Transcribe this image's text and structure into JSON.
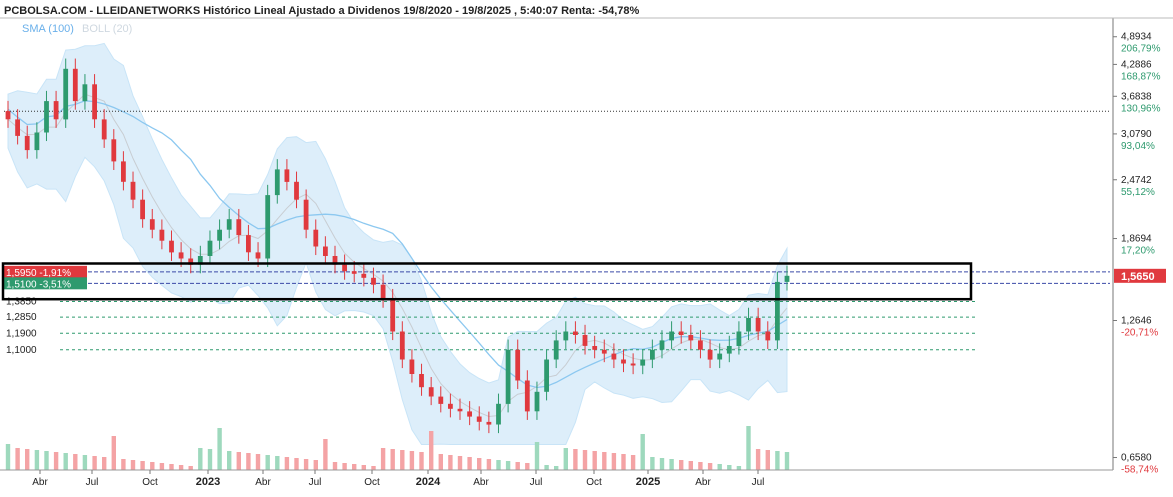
{
  "title": "PCBOLSA.COM - LLEIDANETWORKS Histórico Lineal Ajustado a Dividenos 19/8/2020 - 19/8/2025 , 5:40:07 Renta: -54,78%",
  "indicators": [
    {
      "label": "SMA (100)",
      "color": "#6ab0ea"
    },
    {
      "label": "BOLL (20)",
      "color": "#cfd8e0"
    }
  ],
  "colors": {
    "up": "#2e9a6e",
    "down": "#e0393e",
    "boll_fill": "#d8ecfa",
    "sma": "#8cc8f0",
    "box": "#000000"
  },
  "chart_data": {
    "type": "candlestick",
    "y_scale": "log",
    "ylim": [
      0.62,
      5.3
    ],
    "x_ticks": [
      {
        "label": "Abr",
        "year": false
      },
      {
        "label": "Jul",
        "year": false
      },
      {
        "label": "Oct",
        "year": false
      },
      {
        "label": "2023",
        "year": true
      },
      {
        "label": "Abr",
        "year": false
      },
      {
        "label": "Jul",
        "year": false
      },
      {
        "label": "Oct",
        "year": false
      },
      {
        "label": "2024",
        "year": true
      },
      {
        "label": "Abr",
        "year": false
      },
      {
        "label": "Jul",
        "year": false
      },
      {
        "label": "Oct",
        "year": false
      },
      {
        "label": "2025",
        "year": true
      },
      {
        "label": "Abr",
        "year": false
      },
      {
        "label": "Jul",
        "year": false
      }
    ],
    "y_ticks": [
      {
        "value": 4.8934,
        "label": "4,8934",
        "pct": "206,79%",
        "neg": false
      },
      {
        "value": 4.2886,
        "label": "4,2886",
        "pct": "168,87%",
        "neg": false
      },
      {
        "value": 3.6838,
        "label": "3,6838",
        "pct": "130,96%",
        "neg": false
      },
      {
        "value": 3.079,
        "label": "3,0790",
        "pct": "93,04%",
        "neg": false
      },
      {
        "value": 2.4742,
        "label": "2,4742",
        "pct": "55,12%",
        "neg": false
      },
      {
        "value": 1.8694,
        "label": "1,8694",
        "pct": "17,20%",
        "neg": false
      },
      {
        "value": 1.2646,
        "label": "1,2646",
        "pct": "-20,71%",
        "neg": true
      },
      {
        "value": 0.658,
        "label": "0,6580",
        "pct": "-58,74%",
        "neg": true
      }
    ],
    "last_price": {
      "value": 1.565,
      "label": "1,5650"
    },
    "reference_line": 3.43,
    "marker_levels": [
      {
        "value": 1.595,
        "label": "1,5950 -1,91%",
        "color": "#e0393e"
      },
      {
        "value": 1.51,
        "label": "1,5100 -3,51%",
        "color": "#2e9a6e"
      }
    ],
    "support_levels": [
      {
        "value": 1.385,
        "label": "1,3850"
      },
      {
        "value": 1.285,
        "label": "1,2850"
      },
      {
        "value": 1.19,
        "label": "1,1900"
      },
      {
        "value": 1.1,
        "label": "1,1000"
      }
    ],
    "highlight_box": {
      "from": 1.4,
      "to": 1.66
    },
    "series_close": [
      3.3,
      3.05,
      2.85,
      3.1,
      3.6,
      3.3,
      4.2,
      3.6,
      3.9,
      3.3,
      3.0,
      2.7,
      2.45,
      2.25,
      2.05,
      1.95,
      1.85,
      1.75,
      1.7,
      1.65,
      1.72,
      1.85,
      1.95,
      2.05,
      1.9,
      1.75,
      1.7,
      2.3,
      2.6,
      2.45,
      2.25,
      1.95,
      1.8,
      1.72,
      1.65,
      1.6,
      1.58,
      1.55,
      1.5,
      1.4,
      1.2,
      1.05,
      0.98,
      0.92,
      0.88,
      0.85,
      0.83,
      0.82,
      0.8,
      0.78,
      0.77,
      0.85,
      1.1,
      0.95,
      0.82,
      0.9,
      1.05,
      1.15,
      1.2,
      1.18,
      1.12,
      1.1,
      1.08,
      1.05,
      1.03,
      1.02,
      1.05,
      1.1,
      1.15,
      1.2,
      1.18,
      1.15,
      1.1,
      1.05,
      1.08,
      1.12,
      1.2,
      1.28,
      1.2,
      1.15,
      1.52,
      1.565
    ]
  }
}
